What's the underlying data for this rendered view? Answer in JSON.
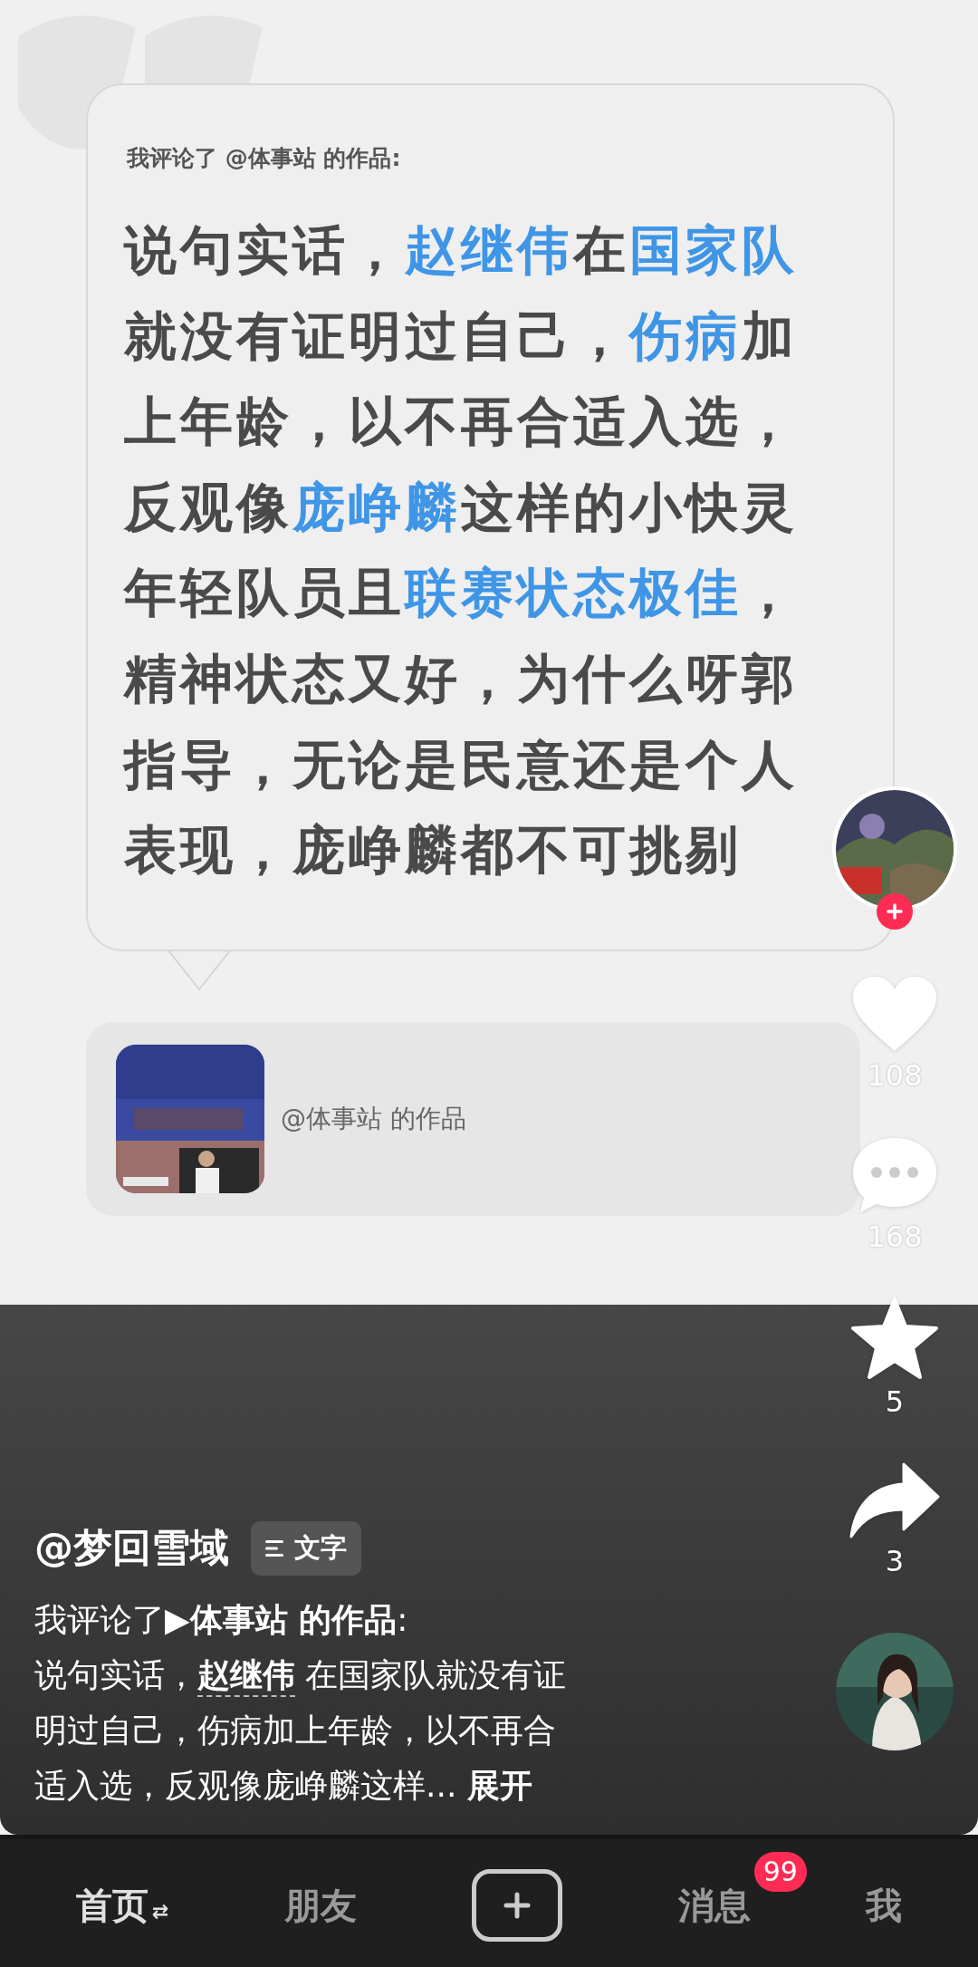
{
  "comment_card": {
    "header": "我评论了 @体事站 的作品:",
    "lines": [
      [
        {
          "text": "说句实话，",
          "highlight": false
        },
        {
          "text": "赵继伟",
          "highlight": true
        },
        {
          "text": "在",
          "highlight": false
        },
        {
          "text": "国家队",
          "highlight": true
        }
      ],
      [
        {
          "text": "就没有证明过自己，",
          "highlight": false
        },
        {
          "text": "伤病",
          "highlight": true
        },
        {
          "text": "加",
          "highlight": false
        }
      ],
      [
        {
          "text": "上年龄，以不再合适入选，",
          "highlight": false
        }
      ],
      [
        {
          "text": "反观像",
          "highlight": false
        },
        {
          "text": "庞峥麟",
          "highlight": true
        },
        {
          "text": "这样的小快灵",
          "highlight": false
        }
      ],
      [
        {
          "text": "年轻队员且",
          "highlight": false
        },
        {
          "text": "联赛状态极佳",
          "highlight": true
        },
        {
          "text": "，",
          "highlight": false
        }
      ],
      [
        {
          "text": "精神状态又好，为什么呀郭",
          "highlight": false
        }
      ],
      [
        {
          "text": "指导，无论是民意还是个人",
          "highlight": false
        }
      ],
      [
        {
          "text": "表现，庞峥麟都不可挑剔",
          "highlight": false
        }
      ]
    ]
  },
  "source_card": {
    "label": "@体事站 的作品"
  },
  "actions": {
    "likes": "108",
    "comments": "168",
    "favorites": "5",
    "shares": "3"
  },
  "author": {
    "name": "@梦回雪域",
    "tag": "文字"
  },
  "description": {
    "lines": [
      [
        {
          "kind": "plain",
          "text": "我评论了"
        },
        {
          "kind": "bold",
          "text": "▶体事站 的作品"
        },
        {
          "kind": "plain",
          "text": ":"
        }
      ],
      [
        {
          "kind": "plain",
          "text": "说句实话，"
        },
        {
          "kind": "mention",
          "text": "赵继伟"
        },
        {
          "kind": "plain",
          "text": " 在国家队就没有证"
        }
      ],
      [
        {
          "kind": "plain",
          "text": "明过自己，伤病加上年龄，以不再合"
        }
      ],
      [
        {
          "kind": "plain",
          "text": "适入选，反观像庞峥麟这样... "
        },
        {
          "kind": "expand",
          "text": "展开"
        }
      ]
    ]
  },
  "nav": [
    {
      "label": "首页",
      "icon": "⇄",
      "selected": true
    },
    {
      "label": "朋友",
      "selected": false
    },
    {
      "kind": "create"
    },
    {
      "label": "消息",
      "badge": "99",
      "selected": false
    },
    {
      "label": "我",
      "selected": false
    }
  ]
}
